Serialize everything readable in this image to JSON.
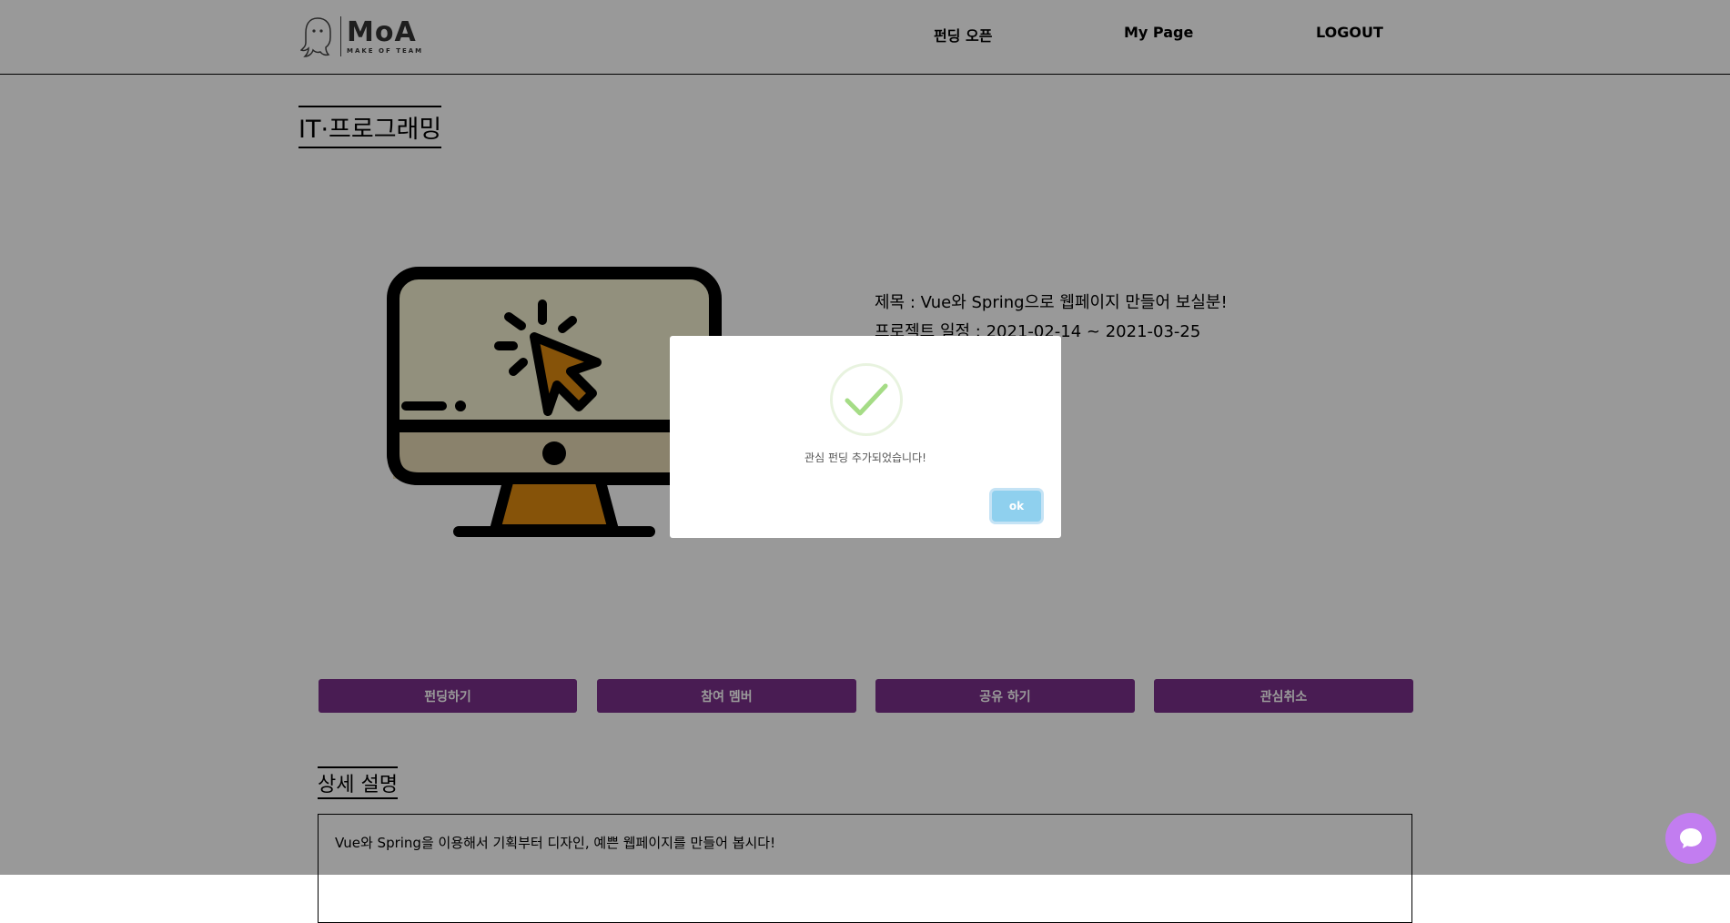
{
  "header": {
    "logo_main": "MoA",
    "logo_sub": "MAKE OF TEAM",
    "nav": [
      "펀딩 오픈",
      "My Page",
      "LOGOUT"
    ]
  },
  "category": "IT·프로그래밍",
  "project": {
    "title_line": "제목 : Vue와 Spring으로 웹페이지 만들어 보실분!",
    "schedule_line": "프로젝트 일정 : 2021-02-14 ~ 2021-03-25"
  },
  "actions": [
    "펀딩하기",
    "참여 멤버",
    "공유 하기",
    "관심취소"
  ],
  "detail": {
    "section_title": "상세 설명",
    "description": "Vue와 Spring을 이용해서 기획부터 디자인, 예쁜 웹페이지를 만들어 봅시다!"
  },
  "modal": {
    "message": "관심 펀딩 추가되었습니다!",
    "ok_label": "ok",
    "icon": "check-icon"
  },
  "colors": {
    "accent": "#7b2f8a",
    "ok_button": "#8fd0ee",
    "check": "#a5dc86",
    "chat": "#c27df0"
  },
  "icons": {
    "logo": "ghost-icon",
    "chat": "chat-bubble-icon",
    "image": "monitor-cursor-icon"
  }
}
